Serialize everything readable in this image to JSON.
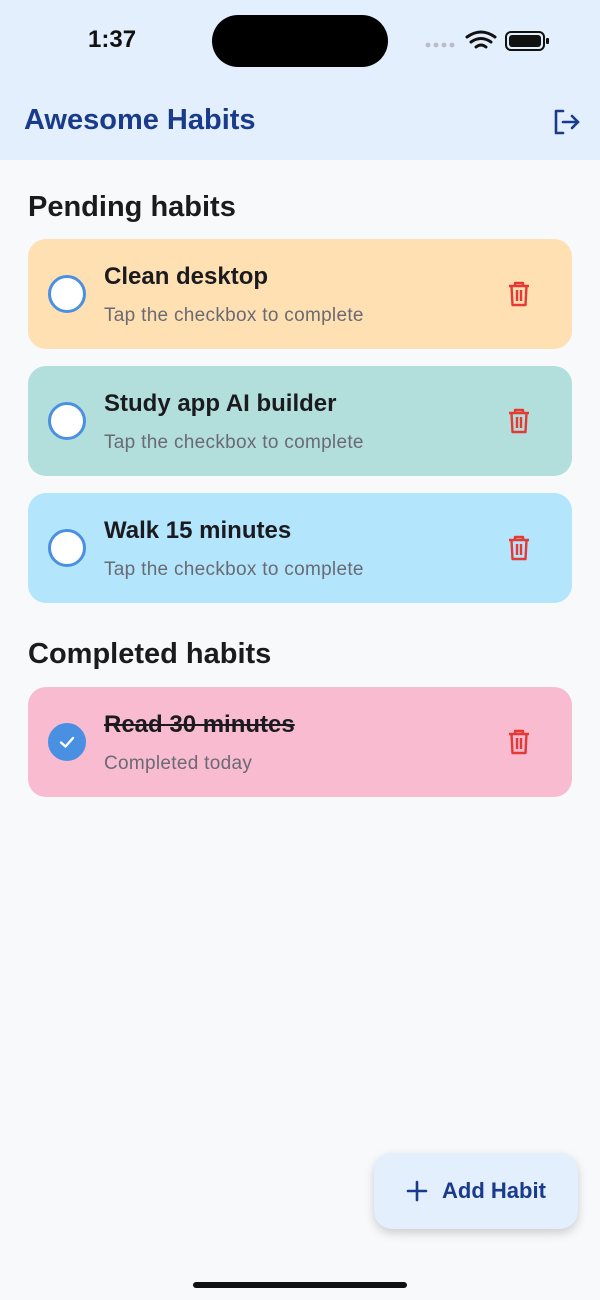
{
  "status_bar": {
    "time": "1:37"
  },
  "app_bar": {
    "title": "Awesome Habits",
    "logout_icon": "logout-icon"
  },
  "sections": {
    "pending": {
      "title": "Pending habits",
      "items": [
        {
          "title": "Clean desktop",
          "subtitle": "Tap the checkbox to complete",
          "color": "#ffe0b2",
          "completed": false
        },
        {
          "title": "Study app AI builder",
          "subtitle": "Tap the checkbox to complete",
          "color": "#b2dfdb",
          "completed": false
        },
        {
          "title": "Walk 15 minutes",
          "subtitle": "Tap the checkbox to complete",
          "color": "#b3e5fc",
          "completed": false
        }
      ]
    },
    "completed": {
      "title": "Completed habits",
      "items": [
        {
          "title": "Read 30 minutes",
          "subtitle": "Completed today",
          "color": "#f8bbd0",
          "completed": true
        }
      ]
    }
  },
  "fab": {
    "label": "Add Habit",
    "icon": "plus-icon"
  },
  "colors": {
    "accent": "#4a90e2",
    "app_bar_bg": "#e3effc",
    "title": "#1a3a8c",
    "delete": "#e53935"
  }
}
